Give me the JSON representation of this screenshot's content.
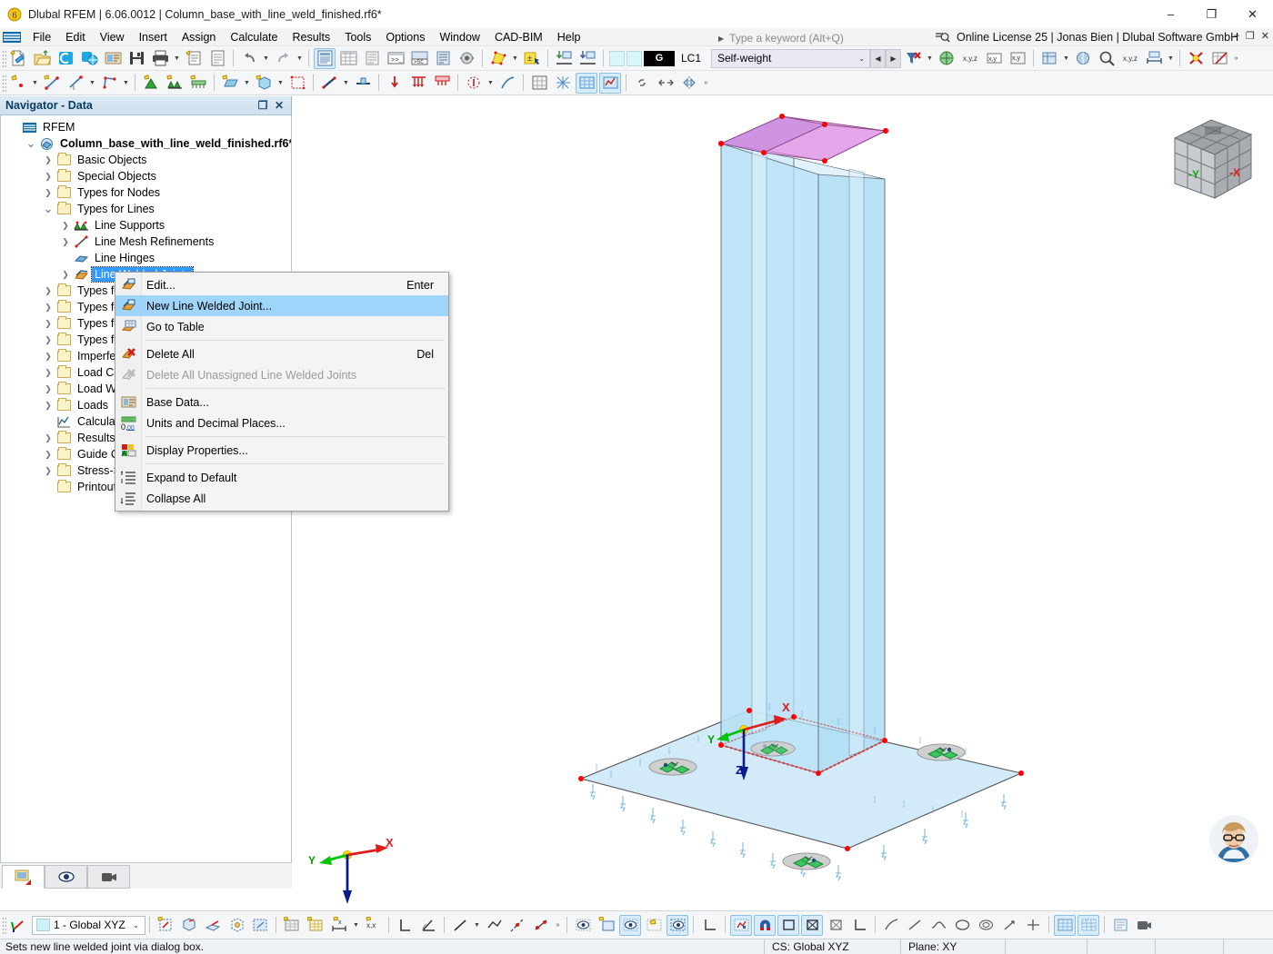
{
  "window": {
    "title": "Dlubal RFEM | 6.06.0012 | Column_base_with_line_weld_finished.rf6*",
    "minimize": "–",
    "maximize": "❐",
    "close": "✕"
  },
  "menubar": {
    "items": [
      "File",
      "Edit",
      "View",
      "Insert",
      "Assign",
      "Calculate",
      "Results",
      "Tools",
      "Options",
      "Window",
      "CAD-BIM",
      "Help"
    ],
    "search_placeholder": "Type a keyword (Alt+Q)",
    "license": "Online License 25 | Jonas Bien | Dlubal Software GmbH",
    "doc_minimize": "–",
    "doc_restore": "❐",
    "doc_close": "✕"
  },
  "toolbar": {
    "loadcase": {
      "badge": "G",
      "id": "LC1",
      "name": "Self-weight",
      "caret": "⌄",
      "prev": "◀",
      "next": "▶"
    }
  },
  "navigator": {
    "title": "Navigator - Data",
    "undock": "❐",
    "close": "✕",
    "tree": [
      {
        "label": "RFEM",
        "indent": 0,
        "twisty": "",
        "icon": "rfem-icon",
        "bold": false,
        "selected": false
      },
      {
        "label": "Column_base_with_line_weld_finished.rf6*",
        "indent": 1,
        "twisty": "v",
        "icon": "model-icon",
        "bold": true,
        "selected": false
      },
      {
        "label": "Basic Objects",
        "indent": 2,
        "twisty": ">",
        "icon": "folder",
        "bold": false,
        "selected": false
      },
      {
        "label": "Special Objects",
        "indent": 2,
        "twisty": ">",
        "icon": "folder",
        "bold": false,
        "selected": false
      },
      {
        "label": "Types for Nodes",
        "indent": 2,
        "twisty": ">",
        "icon": "folder",
        "bold": false,
        "selected": false
      },
      {
        "label": "Types for Lines",
        "indent": 2,
        "twisty": "v",
        "icon": "folder-open",
        "bold": false,
        "selected": false
      },
      {
        "label": "Line Supports",
        "indent": 3,
        "twisty": ">",
        "icon": "line-support-icon",
        "bold": false,
        "selected": false
      },
      {
        "label": "Line Mesh Refinements",
        "indent": 3,
        "twisty": ">",
        "icon": "line-mesh-icon",
        "bold": false,
        "selected": false
      },
      {
        "label": "Line Hinges",
        "indent": 3,
        "twisty": "",
        "icon": "line-hinge-icon",
        "bold": false,
        "selected": false
      },
      {
        "label": "Line Welded Joints",
        "indent": 3,
        "twisty": ">",
        "icon": "line-weld-icon",
        "bold": false,
        "selected": true
      },
      {
        "label": "Types for Members",
        "indent": 2,
        "twisty": ">",
        "icon": "folder",
        "bold": false,
        "selected": false
      },
      {
        "label": "Types for Surfaces",
        "indent": 2,
        "twisty": ">",
        "icon": "folder",
        "bold": false,
        "selected": false
      },
      {
        "label": "Types for Solids",
        "indent": 2,
        "twisty": ">",
        "icon": "folder",
        "bold": false,
        "selected": false
      },
      {
        "label": "Types for Special Objects",
        "indent": 2,
        "twisty": ">",
        "icon": "folder",
        "bold": false,
        "selected": false
      },
      {
        "label": "Imperfections",
        "indent": 2,
        "twisty": ">",
        "icon": "folder",
        "bold": false,
        "selected": false
      },
      {
        "label": "Load Cases and Combinations",
        "indent": 2,
        "twisty": ">",
        "icon": "folder",
        "bold": false,
        "selected": false
      },
      {
        "label": "Load Wizards",
        "indent": 2,
        "twisty": ">",
        "icon": "folder",
        "bold": false,
        "selected": false
      },
      {
        "label": "Loads",
        "indent": 2,
        "twisty": ">",
        "icon": "folder",
        "bold": false,
        "selected": false
      },
      {
        "label": "Calculation Diagrams",
        "indent": 2,
        "twisty": "",
        "icon": "calc-icon",
        "bold": false,
        "selected": false
      },
      {
        "label": "Results",
        "indent": 2,
        "twisty": ">",
        "icon": "folder",
        "bold": false,
        "selected": false
      },
      {
        "label": "Guide Objects",
        "indent": 2,
        "twisty": ">",
        "icon": "folder",
        "bold": false,
        "selected": false
      },
      {
        "label": "Stress-Strain Analysis",
        "indent": 2,
        "twisty": ">",
        "icon": "folder",
        "bold": false,
        "selected": false
      },
      {
        "label": "Printout Reports",
        "indent": 2,
        "twisty": "",
        "icon": "folder",
        "bold": false,
        "selected": false
      }
    ],
    "tabs": [
      "data-navigator-tab",
      "display-navigator-tab",
      "views-navigator-tab"
    ]
  },
  "context_menu": {
    "items": [
      {
        "label": "Edit...",
        "shortcut": "Enter",
        "icon": "edit-weld-icon",
        "disabled": false,
        "highlighted": false,
        "sep_after": false
      },
      {
        "label": "New Line Welded Joint...",
        "shortcut": "",
        "icon": "new-weld-icon",
        "disabled": false,
        "highlighted": true,
        "sep_after": false
      },
      {
        "label": "Go to Table",
        "shortcut": "",
        "icon": "table-icon",
        "disabled": false,
        "highlighted": false,
        "sep_after": true
      },
      {
        "label": "Delete All",
        "shortcut": "Del",
        "icon": "delete-icon",
        "disabled": false,
        "highlighted": false,
        "sep_after": false
      },
      {
        "label": "Delete All Unassigned Line Welded Joints",
        "shortcut": "",
        "icon": "delete-dim-icon",
        "disabled": true,
        "highlighted": false,
        "sep_after": true
      },
      {
        "label": "Base Data...",
        "shortcut": "",
        "icon": "base-data-icon",
        "disabled": false,
        "highlighted": false,
        "sep_after": false
      },
      {
        "label": "Units and Decimal Places...",
        "shortcut": "",
        "icon": "units-icon",
        "disabled": false,
        "highlighted": false,
        "sep_after": true
      },
      {
        "label": "Display Properties...",
        "shortcut": "",
        "icon": "display-prop-icon",
        "disabled": false,
        "highlighted": false,
        "sep_after": true
      },
      {
        "label": "Expand to Default",
        "shortcut": "",
        "icon": "expand-icon",
        "disabled": false,
        "highlighted": false,
        "sep_after": false
      },
      {
        "label": "Collapse All",
        "shortcut": "",
        "icon": "collapse-icon",
        "disabled": false,
        "highlighted": false,
        "sep_after": false
      }
    ]
  },
  "viewport": {
    "view_cube": {
      "face_left": "-Y",
      "face_right": "-X"
    },
    "axis_triad": {
      "x": "X",
      "y": "Y",
      "z": "Z"
    },
    "model_axes": {
      "x": "X",
      "y": "Y",
      "z": "Z"
    },
    "colors": {
      "surface_fill": "#bfe4f7",
      "surface_top": "#f3a8e8",
      "node": "#ff0000",
      "axis_x": "#e01b1b",
      "axis_y": "#00c400",
      "axis_z": "#0b1a8c",
      "support": "#35c35a"
    }
  },
  "bottom_toolbar": {
    "cs_value": "1 - Global XYZ",
    "cs_caret": "⌄",
    "overflow": "»"
  },
  "statusbar": {
    "message": "Sets new line welded joint via dialog box.",
    "cs": "CS: Global XYZ",
    "plane": "Plane: XY"
  }
}
